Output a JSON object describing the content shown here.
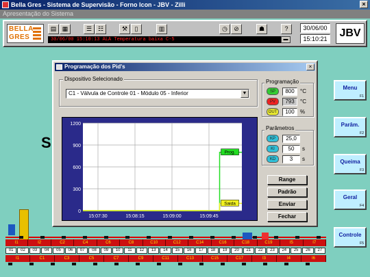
{
  "window": {
    "title": "Bella Gres - Sistema de Supervisão - Forno Icon - JBV - Zilli",
    "subtitle": "Apresentação do Sistema",
    "close": "×"
  },
  "toolbar": {
    "logo_line1": "BELLA",
    "logo_line2": "GRES",
    "alarm_text": "30/06/00  15:10:13  ALA  Temperatura baixa  C-5",
    "date": "30/06/00",
    "time": "15:10:21",
    "station": "JBV"
  },
  "background": {
    "letter": "S"
  },
  "sidebar": {
    "buttons": [
      {
        "label": "Menu",
        "key": "F1"
      },
      {
        "label": "Parâm.",
        "key": "F2"
      },
      {
        "label": "Queima",
        "key": "F3"
      },
      {
        "label": "Geral",
        "key": "F4"
      },
      {
        "label": "Controle",
        "key": "F5"
      }
    ]
  },
  "dialog": {
    "title": "Programação dos Pid's",
    "close": "×",
    "device_label": "Dispositivo Selecionado",
    "device_value": "C1 - Válvula de Controle 01 - Módulo 05 - Inferior",
    "programacao_label": "Programação",
    "sp": {
      "tag": "SP",
      "value": "800",
      "unit": "°C",
      "color": "#33cc33"
    },
    "pv": {
      "tag": "PV",
      "value": "793",
      "unit": "°C",
      "color": "#ee2222"
    },
    "out": {
      "tag": "OUT",
      "value": "100",
      "unit": "%",
      "color": "#e8e830"
    },
    "parametros_label": "Parâmetros",
    "kp": {
      "tag": "KP",
      "value": "25,0",
      "unit": ""
    },
    "ki": {
      "tag": "KI",
      "value": "50",
      "unit": "s"
    },
    "kd": {
      "tag": "KD",
      "value": "3",
      "unit": "s"
    },
    "buttons": {
      "range": "Range",
      "padrao": "Padrão",
      "enviar": "Enviar",
      "fechar": "Fechar"
    }
  },
  "chart_data": {
    "type": "line",
    "title": "",
    "xlabel": "",
    "ylabel": "",
    "ylim": [
      0,
      1200
    ],
    "yticks": [
      "0",
      "300",
      "600",
      "900",
      "1200"
    ],
    "xticks": [
      "15:07:30",
      "15:08:15",
      "15:09:00",
      "15:09:45"
    ],
    "series": [
      {
        "name": "Prog.",
        "color": "#22dd22",
        "x": [
          0,
          0.86,
          0.86,
          1.0
        ],
        "values": [
          0,
          0,
          800,
          800
        ]
      },
      {
        "name": "Saida",
        "color": "#f0f020",
        "x": [
          0,
          0.86,
          0.86,
          1.0
        ],
        "values": [
          0,
          0,
          100,
          100
        ]
      }
    ]
  },
  "plant": {
    "top_zones": [
      "I1",
      "I2",
      "C2",
      "C4",
      "C6",
      "C8",
      "C10",
      "C12",
      "C14",
      "C16",
      "C18",
      "C19",
      "I5",
      "I7"
    ],
    "modules": [
      "01",
      "02",
      "03",
      "04",
      "05",
      "06",
      "07",
      "08",
      "09",
      "10",
      "11",
      "12",
      "13",
      "14",
      "15",
      "16",
      "17",
      "18",
      "19",
      "20",
      "21",
      "22",
      "23",
      "24",
      "25",
      "26",
      "27"
    ],
    "bottom_zones": [
      "I1",
      "C1",
      "C3",
      "C5",
      "C7",
      "C9",
      "C11",
      "C13",
      "C15",
      "C17",
      "I3",
      "I4",
      "I6"
    ]
  }
}
